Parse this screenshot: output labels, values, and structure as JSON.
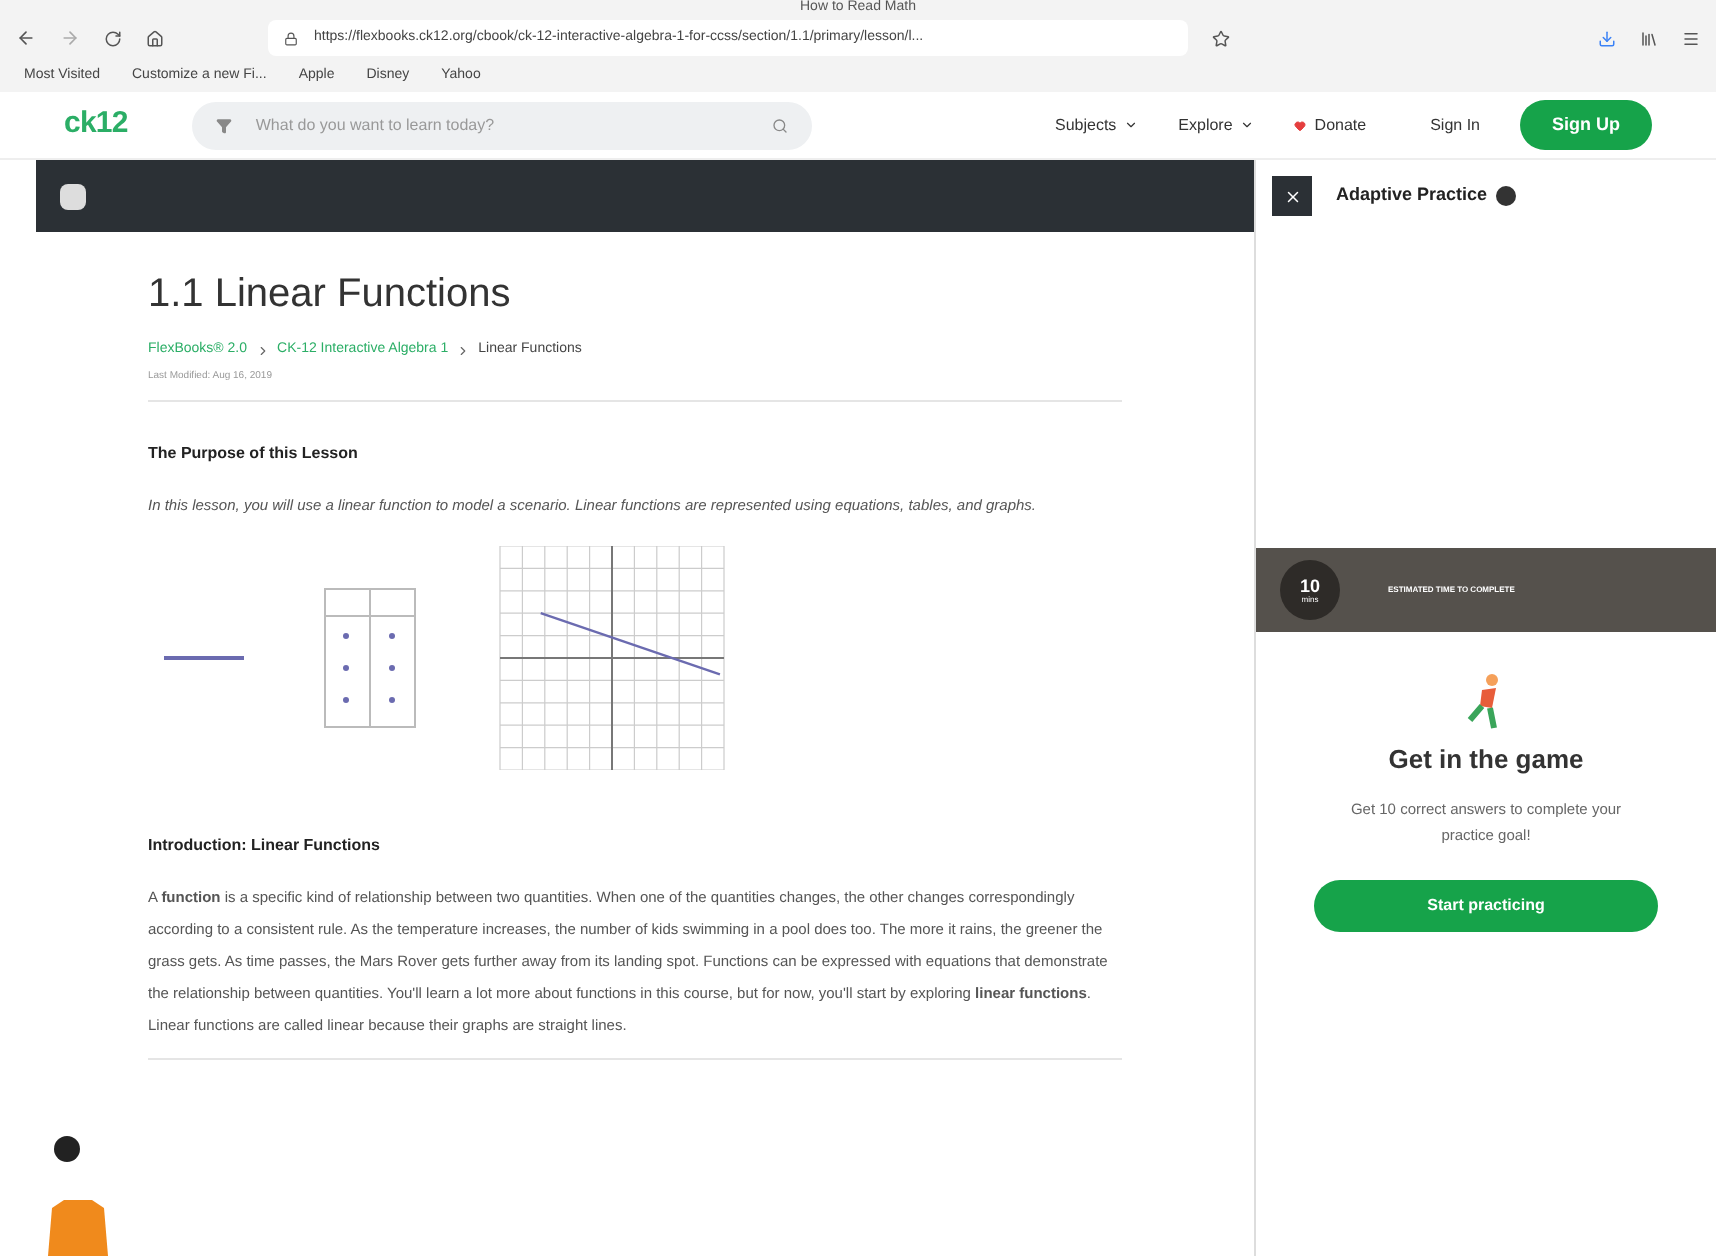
{
  "browser": {
    "tab_title": "How to Read Math",
    "url": "https://flexbooks.ck12.org/cbook/ck-12-interactive-algebra-1-for-ccss/section/1.1/primary/lesson/l...",
    "bookmarks": [
      "Most Visited",
      "Customize a new Fi...",
      "Apple",
      "Disney",
      "Yahoo"
    ]
  },
  "site_header": {
    "logo": "ck12",
    "search": {
      "placeholder": "What do you want to learn today?"
    },
    "nav": [
      {
        "label": "Subjects",
        "kind": "menu"
      },
      {
        "label": "Explore",
        "kind": "menu"
      },
      {
        "label": "Donate",
        "kind": "donate"
      },
      {
        "label": "Sign In",
        "kind": "link"
      }
    ],
    "signup": "Sign Up"
  },
  "lesson": {
    "title": "1.1 Linear Functions",
    "breadcrumb": [
      {
        "label": "FlexBooks® 2.0",
        "link": true
      },
      {
        "label": "CK-12 Interactive Algebra 1",
        "link": true
      },
      {
        "label": "Linear Functions",
        "link": false
      }
    ],
    "modified": "Last Modified: Aug 16, 2019",
    "sections": [
      {
        "heading": "The Purpose of this Lesson",
        "text": "*In this lesson, you will use a linear function to model a scenario. Linear functions are represented using equations, tables, and graphs.*",
        "figure": true
      },
      {
        "heading": "Introduction: Linear Functions",
        "text": "A **function** is a specific kind of relationship between two quantities. When one of the quantities changes, the other changes correspondingly according to a consistent rule. As the temperature increases, the number of kids swimming in a pool does too. The more it rains, the greener the grass gets. As time passes, the Mars Rover gets further away from its landing spot. Functions can be expressed with equations that demonstrate the relationship between quantities. You'll learn a lot more about functions in this course, but for now, you'll start by exploring **linear functions**. Linear functions are called linear because their graphs are straight lines.",
        "figure": false
      }
    ]
  },
  "practice": {
    "title": "Adaptive Practice",
    "time": "10",
    "time_unit": "mins",
    "time_label": "ESTIMATED TIME TO COMPLETE",
    "heading": "Get in the game",
    "text": "Get 10 correct answers to complete your practice goal!",
    "button": "Start practicing"
  }
}
